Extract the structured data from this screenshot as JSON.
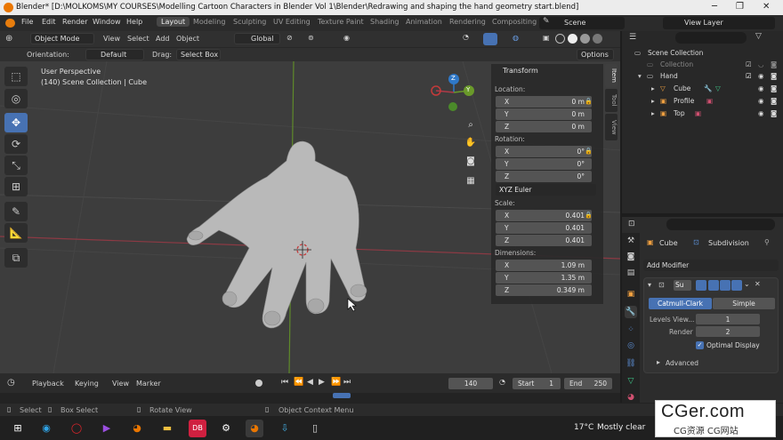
{
  "window": {
    "title": "Blender* [D:\\MOLKOMS\\MY COURSES\\Modelling  Cartoon Characters in Blender Vol 1\\Blender\\Redrawing and shaping the hand geometry start.blend]",
    "minimize": "─",
    "maximize": "❐",
    "close": "✕"
  },
  "menu": [
    "File",
    "Edit",
    "Render",
    "Window",
    "Help"
  ],
  "workspaces": [
    "Layout",
    "Modeling",
    "Sculpting",
    "UV Editing",
    "Texture Paint",
    "Shading",
    "Animation",
    "Rendering",
    "Compositing"
  ],
  "scene": {
    "name": "Scene",
    "view_layer": "View Layer"
  },
  "viewport_header": {
    "mode": "Object Mode",
    "menus": [
      "View",
      "Select",
      "Add",
      "Object"
    ],
    "transform_orientation": "Global"
  },
  "tool_header": {
    "orientation_label": "Orientation:",
    "orientation_value": "Default",
    "drag_label": "Drag:",
    "drag_value": "Select Box",
    "options_label": "Options"
  },
  "viewport": {
    "perspective": "User Perspective",
    "collection_info": "(140) Scene Collection | Cube",
    "gizmo_z": "Z",
    "gizmo_y": "Y"
  },
  "n_panel": {
    "title": "Transform",
    "location_label": "Location:",
    "location": [
      {
        "axis": "X",
        "value": "0 m"
      },
      {
        "axis": "Y",
        "value": "0 m"
      },
      {
        "axis": "Z",
        "value": "0 m"
      }
    ],
    "rotation_label": "Rotation:",
    "rotation": [
      {
        "axis": "X",
        "value": "0°"
      },
      {
        "axis": "Y",
        "value": "0°"
      },
      {
        "axis": "Z",
        "value": "0°"
      }
    ],
    "rotation_mode": "XYZ Euler",
    "scale_label": "Scale:",
    "scale": [
      {
        "axis": "X",
        "value": "0.401"
      },
      {
        "axis": "Y",
        "value": "0.401"
      },
      {
        "axis": "Z",
        "value": "0.401"
      }
    ],
    "dimensions_label": "Dimensions:",
    "dimensions": [
      {
        "axis": "X",
        "value": "1.09 m"
      },
      {
        "axis": "Y",
        "value": "1.35 m"
      },
      {
        "axis": "Z",
        "value": "0.349 m"
      }
    ],
    "tabs": [
      "Item",
      "Tool",
      "View"
    ]
  },
  "timeline": {
    "menus": [
      "Playback",
      "Keying",
      "View",
      "Marker"
    ],
    "current_frame": "140",
    "start_label": "Start",
    "start_value": "1",
    "end_label": "End",
    "end_value": "250"
  },
  "statusbar": {
    "select": "Select",
    "box_select": "Box Select",
    "rotate_view": "Rotate View",
    "context_menu": "Object Context Menu"
  },
  "outliner": {
    "root": "Scene Collection",
    "items": [
      {
        "name": "Collection",
        "depth": 1
      },
      {
        "name": "Hand",
        "depth": 1
      },
      {
        "name": "Cube",
        "depth": 2
      },
      {
        "name": "Profile",
        "depth": 2
      },
      {
        "name": "Top",
        "depth": 2
      }
    ]
  },
  "properties": {
    "breadcrumb_object": "Cube",
    "breadcrumb_modifier": "Subdivision",
    "add_modifier": "Add Modifier",
    "modifier_short_name": "Su",
    "catmull_clark": "Catmull-Clark",
    "simple": "Simple",
    "levels_viewport_label": "Levels View...",
    "levels_viewport_value": "1",
    "render_label": "Render",
    "render_value": "2",
    "optimal_display": "Optimal Display",
    "advanced": "Advanced"
  },
  "taskbar": {
    "temperature": "17°C",
    "weather": "Mostly clear"
  },
  "watermark": {
    "main": "CGer.com",
    "sub": "CG资源 CG网站"
  },
  "colors": {
    "accent": "#4772b3",
    "x_axis": "#b03a48",
    "y_axis": "#6a9a2a",
    "z_axis": "#2f78c8"
  }
}
